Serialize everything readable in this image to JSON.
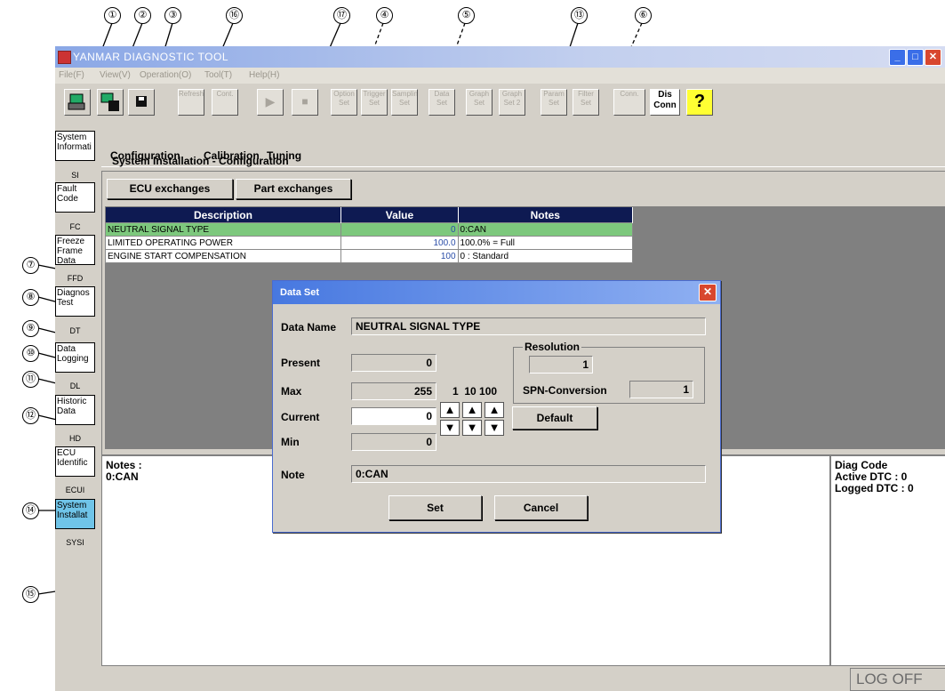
{
  "window": {
    "title": "YANMAR DIAGNOSTIC TOOL",
    "controls": [
      "_",
      "□",
      "✕"
    ]
  },
  "menu": [
    "File(F)",
    "View(V)",
    "Operation(O)",
    "Tool(T)",
    "Help(H)"
  ],
  "toolbar": {
    "buttons": [
      "Refresh",
      "Cont.",
      "▶",
      "■",
      "Option Set",
      "Trigger Set",
      "Sampling Set",
      "Data Set",
      "Graph Set",
      "Graph Set 2",
      "Param Set",
      "Filter Set",
      "Conn.",
      "Dis Conn",
      "?"
    ]
  },
  "sidebar": {
    "items": [
      {
        "label": "System Informati",
        "abbr": "SI"
      },
      {
        "label": "Fault Code",
        "abbr": "FC"
      },
      {
        "label": "Freeze Frame Data",
        "abbr": "FFD"
      },
      {
        "label": "Diagnos Test",
        "abbr": "DT"
      },
      {
        "label": "Data Logging",
        "abbr": "DL"
      },
      {
        "label": "Historic Data",
        "abbr": "HD"
      },
      {
        "label": "ECU Identific",
        "abbr": "ECUI"
      },
      {
        "label": "System Installat",
        "abbr": "SYSI"
      }
    ]
  },
  "tabs": [
    "Configuration",
    "Calibration",
    "Tuning"
  ],
  "section_title": "System Installation - Configuration",
  "buttons": {
    "ecu": "ECU exchanges",
    "part": "Part exchanges"
  },
  "table": {
    "headers": [
      "Description",
      "Value",
      "Notes"
    ],
    "rows": [
      {
        "description": "NEUTRAL SIGNAL TYPE",
        "value": "0",
        "notes": "0:CAN"
      },
      {
        "description": "LIMITED OPERATING POWER",
        "value": "100.0",
        "notes": "100.0% = Full"
      },
      {
        "description": "ENGINE START COMPENSATION",
        "value": "100",
        "notes": "0 : Standard"
      }
    ]
  },
  "notes_panel": {
    "label": "Notes :",
    "text": "0:CAN"
  },
  "diag_panel": {
    "title": "Diag Code",
    "active": "Active DTC : 0",
    "logged": "Logged DTC : 0"
  },
  "status": {
    "log": "LOG OFF"
  },
  "dialog": {
    "title": "Data Set",
    "data_name_label": "Data Name",
    "data_name": "NEUTRAL SIGNAL TYPE",
    "present_label": "Present",
    "present": "0",
    "max_label": "Max",
    "max": "255",
    "current_label": "Current",
    "current": "0",
    "min_label": "Min",
    "min": "0",
    "note_label": "Note",
    "note": "0:CAN",
    "step_labels": "1  10 100",
    "resolution_label": "Resolution",
    "resolution": "1",
    "spn_label": "SPN-Conversion",
    "spn": "1",
    "default_label": "Default",
    "set_label": "Set",
    "cancel_label": "Cancel"
  },
  "annotations": [
    "①",
    "②",
    "③",
    "⑯",
    "⑰",
    "④",
    "⑤",
    "⑬",
    "⑥",
    "⑦",
    "⑧",
    "⑨",
    "⑩",
    "⑪",
    "⑫",
    "⑭",
    "⑮"
  ],
  "colors": {
    "table_header": "#0e1a52",
    "highlight_row": "#7dc87d",
    "selected_nav": "#6fc4e8",
    "title_bar": "#4778e0"
  }
}
